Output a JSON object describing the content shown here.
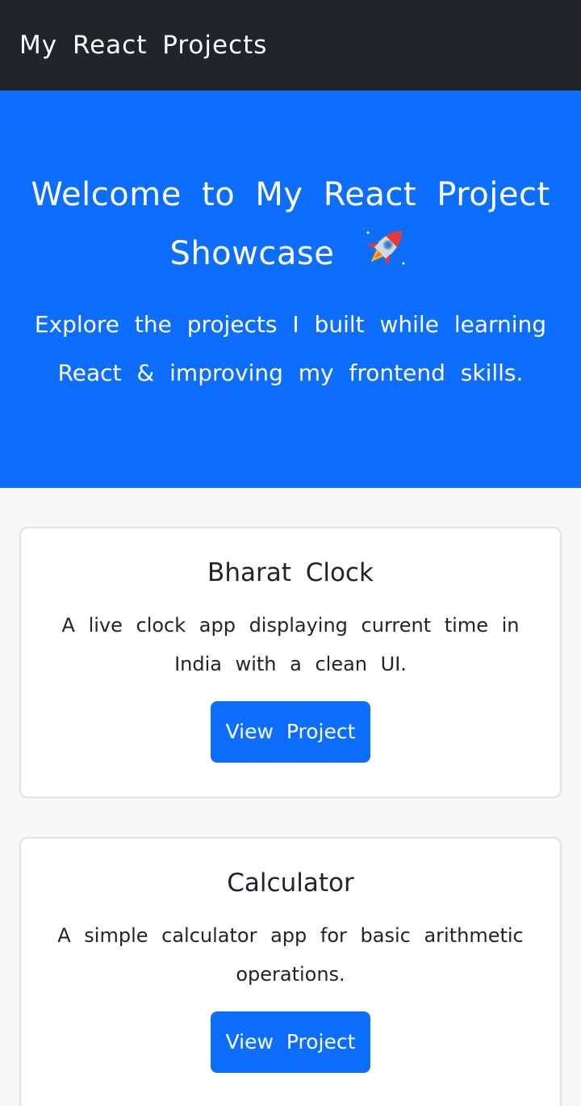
{
  "navbar": {
    "brand": "My React Projects"
  },
  "hero": {
    "title": "Welcome to My React Project Showcase",
    "subtitle": "Explore the projects I built while learning React & improving my frontend skills."
  },
  "projects": [
    {
      "title": "Bharat Clock",
      "description": "A live clock app displaying current time in India with a clean UI.",
      "button_label": "View Project"
    },
    {
      "title": "Calculator",
      "description": "A simple calculator app for basic arithmetic operations.",
      "button_label": "View Project"
    }
  ],
  "colors": {
    "navbar_bg": "#212529",
    "hero_bg": "#0d6efd",
    "button_bg": "#0d6efd",
    "page_bg": "#f6f7f9"
  },
  "icons": {
    "hero_icon": "rocket-icon"
  }
}
